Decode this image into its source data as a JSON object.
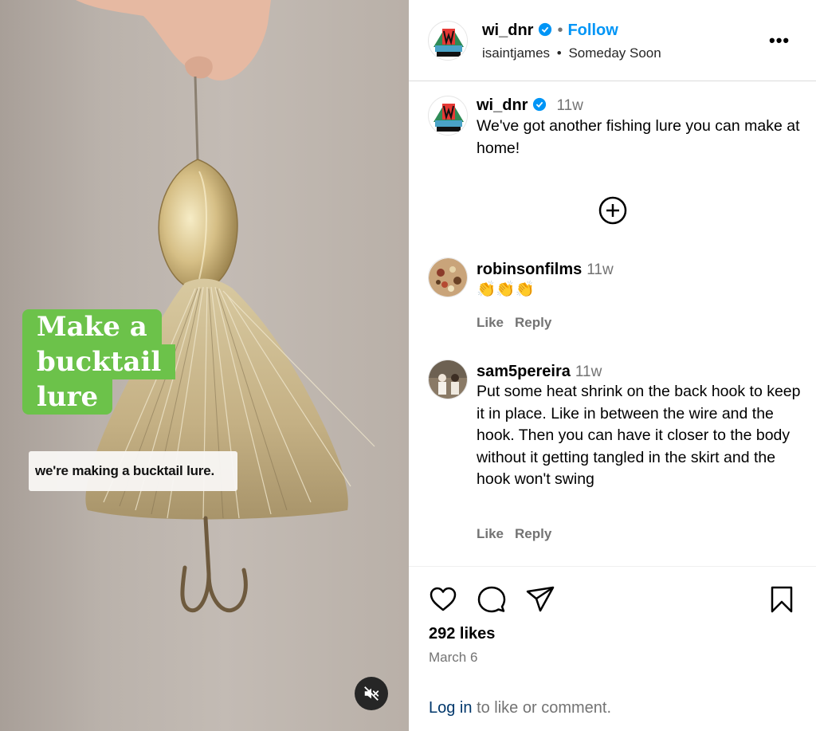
{
  "media": {
    "caption_lines": [
      "Make a",
      "bucktail",
      "lure"
    ],
    "subtitle": "we're making a bucktail lure.",
    "mute_icon": "speaker-muted-icon"
  },
  "header": {
    "username": "wi_dnr",
    "separator": "•",
    "follow_label": "Follow",
    "audio_user": "isaintjames",
    "audio_track": "Someday Soon",
    "more_icon": "more-options-icon"
  },
  "post": {
    "username": "wi_dnr",
    "time": "11w",
    "caption": "We've got another fishing lure you can make at home!",
    "expand_icon": "plus-circle-icon"
  },
  "comments": [
    {
      "username": "robinsonfilms",
      "time": "11w",
      "text": "👏👏👏",
      "like_label": "Like",
      "reply_label": "Reply"
    },
    {
      "username": "sam5pereira",
      "time": "11w",
      "text": "Put some heat shrink on the back hook to keep it in place. Like in between the wire and the hook. Then you can have it closer to the body without it getting tangled in the skirt and the hook won't swing",
      "like_label": "Like",
      "reply_label": "Reply"
    }
  ],
  "footer": {
    "likes": "292 likes",
    "date": "March 6",
    "login_link": "Log in",
    "login_rest": "to like or comment.",
    "icons": [
      "heart-icon",
      "comment-icon",
      "share-icon",
      "bookmark-icon"
    ]
  },
  "colors": {
    "accent": "#0095f6",
    "caption_green": "#6cc24a",
    "muted_text": "#737373",
    "link_dark": "#00376b"
  }
}
